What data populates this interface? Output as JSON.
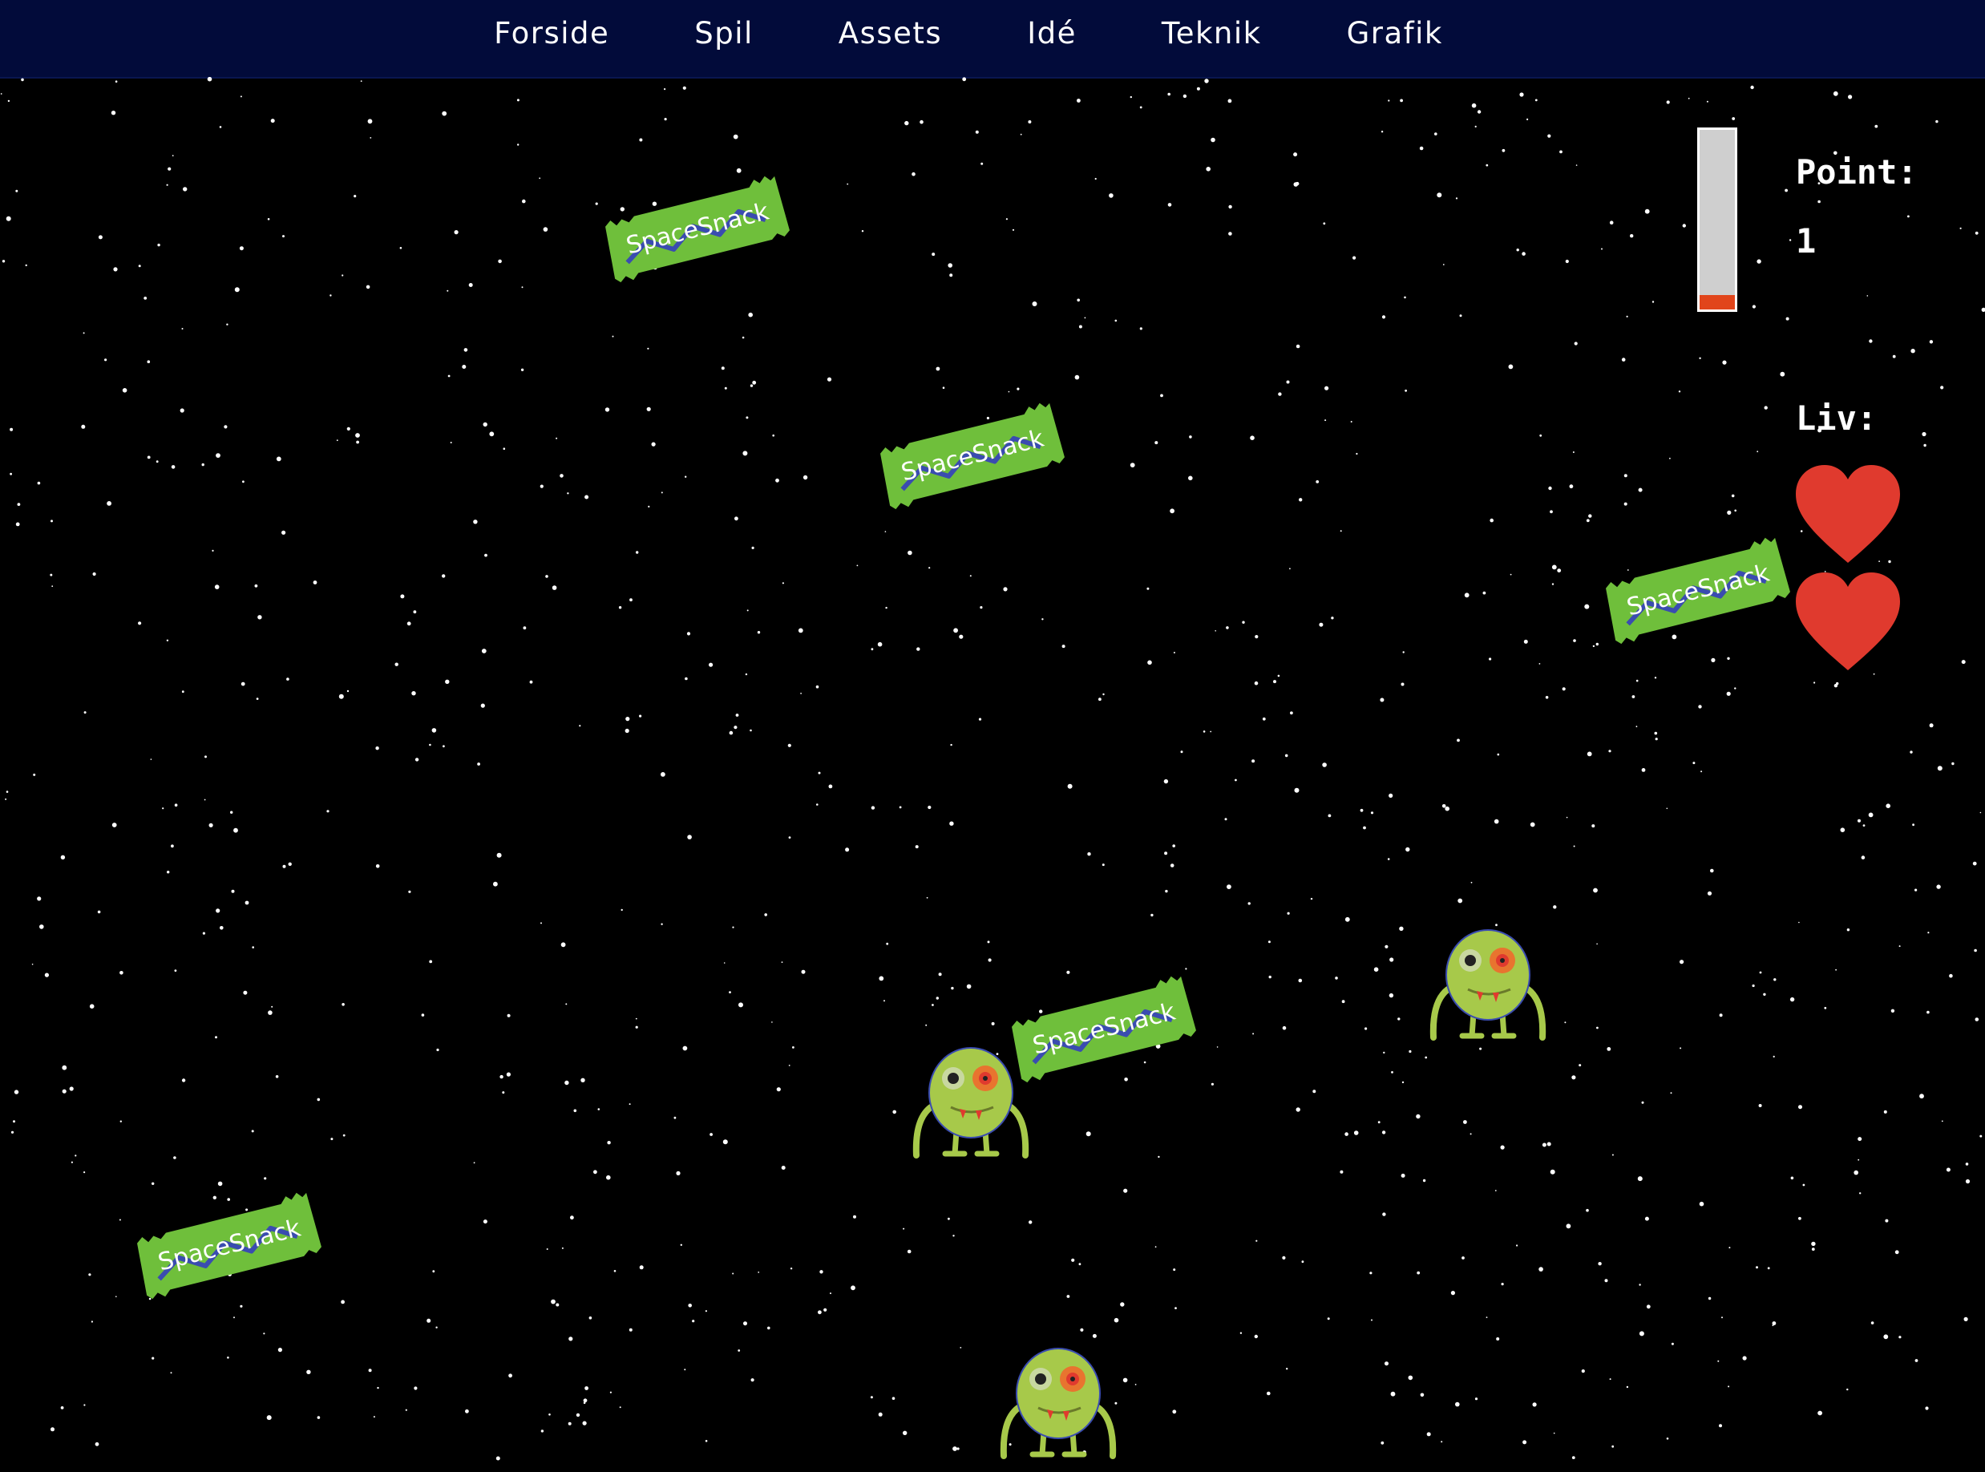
{
  "nav": {
    "items": [
      {
        "label": "Forside"
      },
      {
        "label": "Spil"
      },
      {
        "label": "Assets"
      },
      {
        "label": "Idé"
      },
      {
        "label": "Teknik"
      },
      {
        "label": "Grafik"
      }
    ]
  },
  "game": {
    "snack_text": "SpaceSnack",
    "enemy_icon": "green-alien-icon",
    "life_icon": "heart-icon"
  },
  "hud": {
    "point_label": "Point:",
    "point_value": "1",
    "lives_label": "Liv:",
    "lives_count": 2,
    "meter_fraction": 0.08
  },
  "colors": {
    "nav_background": "#020b3a",
    "snack_green": "#6fbf3b",
    "heart_red": "#e03a2e",
    "meter_fill": "#e1451b"
  }
}
